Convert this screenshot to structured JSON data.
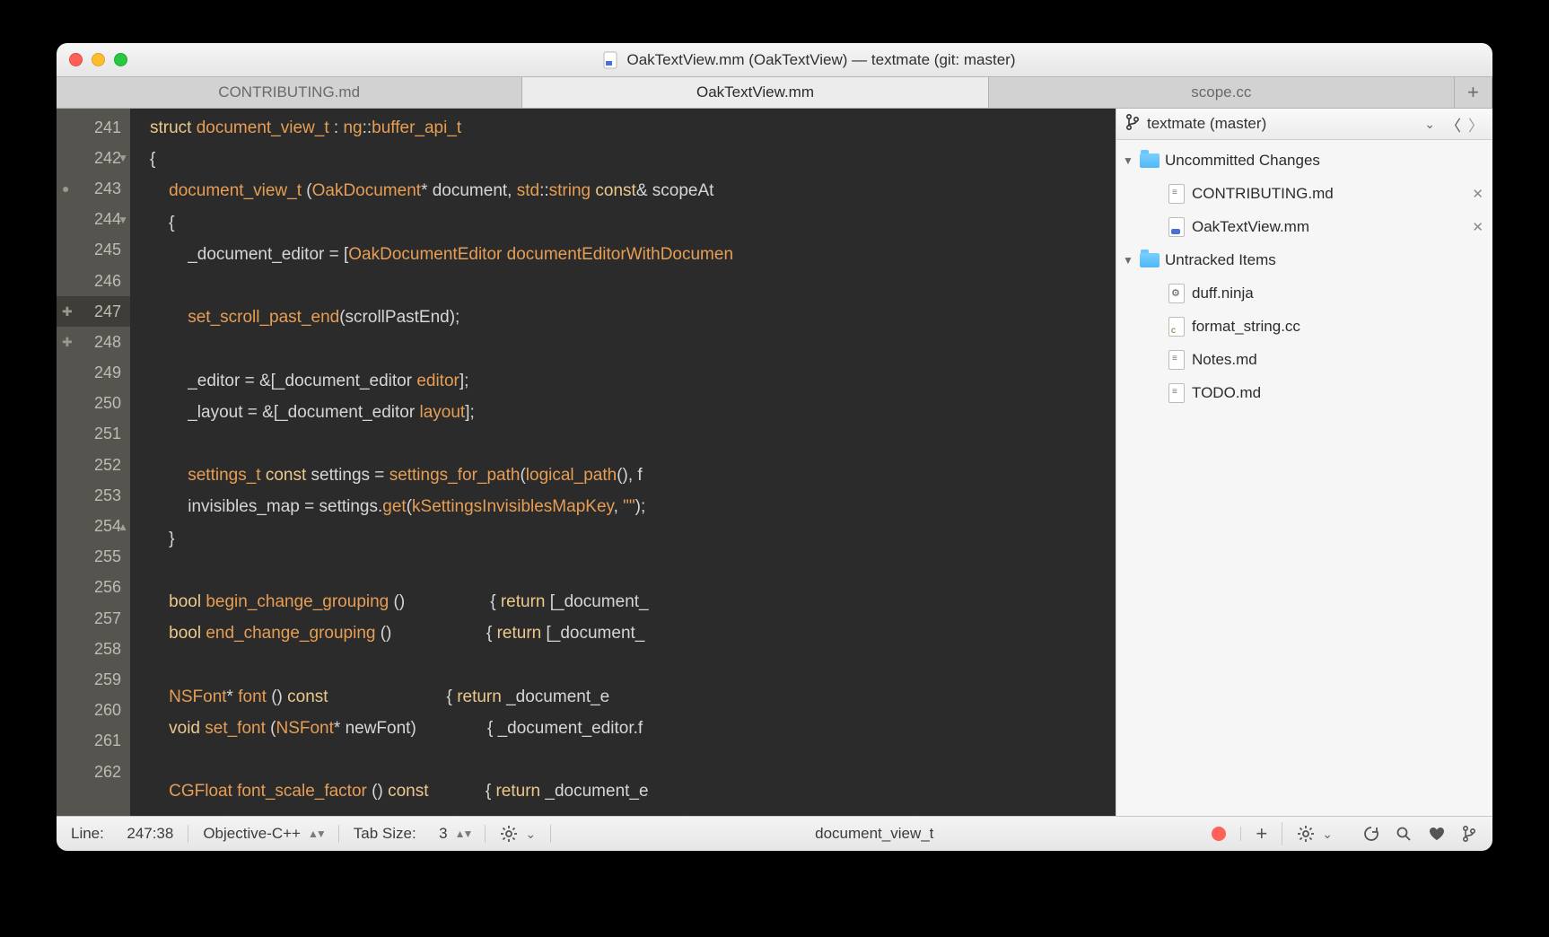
{
  "title": "OakTextView.mm (OakTextView) — textmate (git: master)",
  "tabs": [
    "CONTRIBUTING.md",
    "OakTextView.mm",
    "scope.cc"
  ],
  "activeTab": 1,
  "gutter": {
    "start": 241,
    "end": 262,
    "current": 247,
    "foldDown": [
      242,
      244
    ],
    "foldUp": [
      254
    ],
    "dotMarker": [
      243
    ],
    "plusMarker": [
      247,
      248
    ]
  },
  "code": {
    "lines": [
      [
        [
          "k",
          "struct"
        ],
        [
          "n",
          " "
        ],
        [
          "t",
          "document_view_t"
        ],
        [
          "n",
          " : "
        ],
        [
          "t",
          "ng"
        ],
        [
          "n",
          "::"
        ],
        [
          "t",
          "buffer_api_t"
        ]
      ],
      [
        [
          "n",
          "{"
        ]
      ],
      [
        [
          "n",
          "    "
        ],
        [
          "t",
          "document_view_t"
        ],
        [
          "n",
          " ("
        ],
        [
          "t",
          "OakDocument"
        ],
        [
          "n",
          "* document, "
        ],
        [
          "t",
          "std"
        ],
        [
          "n",
          "::"
        ],
        [
          "t",
          "string"
        ],
        [
          "n",
          " "
        ],
        [
          "k",
          "const"
        ],
        [
          "n",
          "& scopeAt"
        ]
      ],
      [
        [
          "n",
          "    {"
        ]
      ],
      [
        [
          "n",
          "        _document_editor = ["
        ],
        [
          "t",
          "OakDocumentEditor"
        ],
        [
          "n",
          " "
        ],
        [
          "f",
          "documentEditorWithDocumen"
        ]
      ],
      [
        [
          "n",
          ""
        ]
      ],
      [
        [
          "n",
          "        "
        ],
        [
          "f",
          "set_scroll_past_end"
        ],
        [
          "n",
          "(scrollPastEnd);"
        ]
      ],
      [
        [
          "n",
          ""
        ]
      ],
      [
        [
          "n",
          "        _editor = &[_document_editor "
        ],
        [
          "f",
          "editor"
        ],
        [
          "n",
          "];"
        ]
      ],
      [
        [
          "n",
          "        _layout = &[_document_editor "
        ],
        [
          "f",
          "layout"
        ],
        [
          "n",
          "];"
        ]
      ],
      [
        [
          "n",
          ""
        ]
      ],
      [
        [
          "n",
          "        "
        ],
        [
          "t",
          "settings_t"
        ],
        [
          "n",
          " "
        ],
        [
          "k",
          "const"
        ],
        [
          "n",
          " settings = "
        ],
        [
          "f",
          "settings_for_path"
        ],
        [
          "n",
          "("
        ],
        [
          "f",
          "logical_path"
        ],
        [
          "n",
          "(), f"
        ]
      ],
      [
        [
          "n",
          "        invisibles_map = settings."
        ],
        [
          "f",
          "get"
        ],
        [
          "n",
          "("
        ],
        [
          "t",
          "kSettingsInvisiblesMapKey"
        ],
        [
          "n",
          ", "
        ],
        [
          "s",
          "\"\""
        ],
        [
          "n",
          ");"
        ]
      ],
      [
        [
          "n",
          "    }"
        ]
      ],
      [
        [
          "n",
          ""
        ]
      ],
      [
        [
          "n",
          "    "
        ],
        [
          "k",
          "bool"
        ],
        [
          "n",
          " "
        ],
        [
          "t",
          "begin_change_grouping"
        ],
        [
          "n",
          " ()                  { "
        ],
        [
          "k",
          "return"
        ],
        [
          "n",
          " [_document_"
        ]
      ],
      [
        [
          "n",
          "    "
        ],
        [
          "k",
          "bool"
        ],
        [
          "n",
          " "
        ],
        [
          "t",
          "end_change_grouping"
        ],
        [
          "n",
          " ()                    { "
        ],
        [
          "k",
          "return"
        ],
        [
          "n",
          " [_document_"
        ]
      ],
      [
        [
          "n",
          ""
        ]
      ],
      [
        [
          "n",
          "    "
        ],
        [
          "t",
          "NSFont"
        ],
        [
          "n",
          "* "
        ],
        [
          "t",
          "font"
        ],
        [
          "n",
          " () "
        ],
        [
          "k",
          "const"
        ],
        [
          "n",
          "                         { "
        ],
        [
          "k",
          "return"
        ],
        [
          "n",
          " _document_e"
        ]
      ],
      [
        [
          "n",
          "    "
        ],
        [
          "k",
          "void"
        ],
        [
          "n",
          " "
        ],
        [
          "t",
          "set_font"
        ],
        [
          "n",
          " ("
        ],
        [
          "t",
          "NSFont"
        ],
        [
          "n",
          "* newFont)               { _document_editor.f"
        ]
      ],
      [
        [
          "n",
          ""
        ]
      ],
      [
        [
          "n",
          "    "
        ],
        [
          "t",
          "CGFloat"
        ],
        [
          "n",
          " "
        ],
        [
          "t",
          "font_scale_factor"
        ],
        [
          "n",
          " () "
        ],
        [
          "k",
          "const"
        ],
        [
          "n",
          "            { "
        ],
        [
          "k",
          "return"
        ],
        [
          "n",
          " _document_e"
        ]
      ]
    ]
  },
  "sidebar": {
    "header": {
      "repo": "textmate",
      "branch": "master"
    },
    "groups": [
      {
        "name": "Uncommitted Changes",
        "open": true,
        "closable": true,
        "items": [
          {
            "name": "CONTRIBUTING.md",
            "kind": "md"
          },
          {
            "name": "OakTextView.mm",
            "kind": "mm"
          }
        ]
      },
      {
        "name": "Untracked Items",
        "open": true,
        "closable": false,
        "items": [
          {
            "name": "duff.ninja",
            "kind": "ninja"
          },
          {
            "name": "format_string.cc",
            "kind": "cc"
          },
          {
            "name": "Notes.md",
            "kind": "md"
          },
          {
            "name": "TODO.md",
            "kind": "md"
          }
        ]
      }
    ]
  },
  "status": {
    "lineLabel": "Line:",
    "pos": "247:38",
    "language": "Objective-C++",
    "tabLabel": "Tab Size:",
    "tabSize": "3",
    "symbol": "document_view_t"
  }
}
